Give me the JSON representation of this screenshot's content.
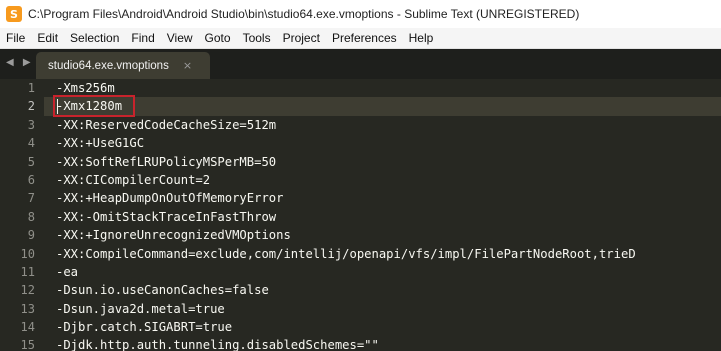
{
  "window": {
    "title": "C:\\Program Files\\Android\\Android Studio\\bin\\studio64.exe.vmoptions - Sublime Text (UNREGISTERED)"
  },
  "app_icon": {
    "glyph": "S"
  },
  "menu": [
    "File",
    "Edit",
    "Selection",
    "Find",
    "View",
    "Goto",
    "Tools",
    "Project",
    "Preferences",
    "Help"
  ],
  "tabs": {
    "arrows": "◀ ▶",
    "active_label": "studio64.exe.vmoptions",
    "close_glyph": "×"
  },
  "editor": {
    "active_line": 2,
    "line_numbers": [
      "1",
      "2",
      "3",
      "4",
      "5",
      "6",
      "7",
      "8",
      "9",
      "10",
      "11",
      "12",
      "13",
      "14",
      "15"
    ],
    "lines": [
      "-Xms256m",
      "-Xmx1280m",
      "-XX:ReservedCodeCacheSize=512m",
      "-XX:+UseG1GC",
      "-XX:SoftRefLRUPolicyMSPerMB=50",
      "-XX:CICompilerCount=2",
      "-XX:+HeapDumpOnOutOfMemoryError",
      "-XX:-OmitStackTraceInFastThrow",
      "-XX:+IgnoreUnrecognizedVMOptions",
      "-XX:CompileCommand=exclude,com/intellij/openapi/vfs/impl/FilePartNodeRoot,trieD",
      "-ea",
      "-Dsun.io.useCanonCaches=false",
      "-Dsun.java2d.metal=true",
      "-Djbr.catch.SIGABRT=true",
      "-Djdk.http.auth.tunneling.disabledSchemes=\"\""
    ]
  },
  "colors": {
    "editor_bg": "#272822",
    "highlight_box": "#c8232c",
    "app_icon": "#f79a1e"
  }
}
